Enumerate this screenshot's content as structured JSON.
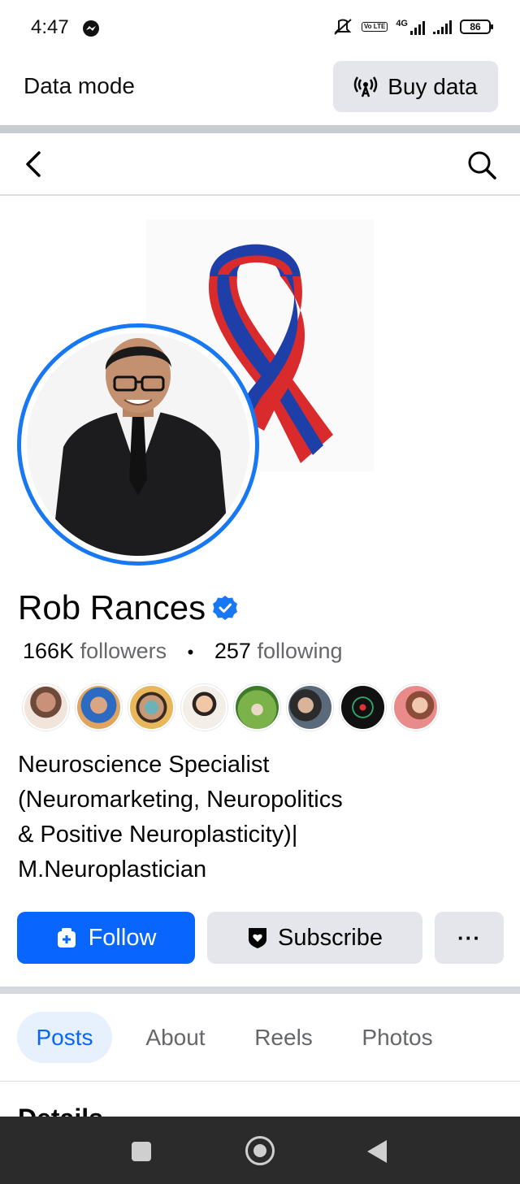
{
  "status_bar": {
    "time": "4:47",
    "network": "4G",
    "volte": "Vo LTE",
    "battery": "86"
  },
  "data_mode": {
    "label": "Data mode",
    "buy_button": "Buy data"
  },
  "profile": {
    "name": "Rob Rances",
    "verified": true,
    "followers_count": "166K",
    "followers_label": "followers",
    "separator": "•",
    "following_count": "257",
    "following_label": "following",
    "bio": [
      "Neuroscience Specialist",
      "(Neuromarketing, Neuropolitics",
      "& Positive Neuroplasticity)|",
      "M.Neuroplastician"
    ]
  },
  "actions": {
    "follow": "Follow",
    "subscribe": "Subscribe",
    "more": "···"
  },
  "tabs": [
    "Posts",
    "About",
    "Reels",
    "Photos"
  ],
  "section_peek": "Details",
  "colors": {
    "accent": "#0866ff",
    "verified_badge": "#1877f2",
    "ribbon_red": "#d92b2b",
    "ribbon_blue": "#1f3fa8"
  }
}
